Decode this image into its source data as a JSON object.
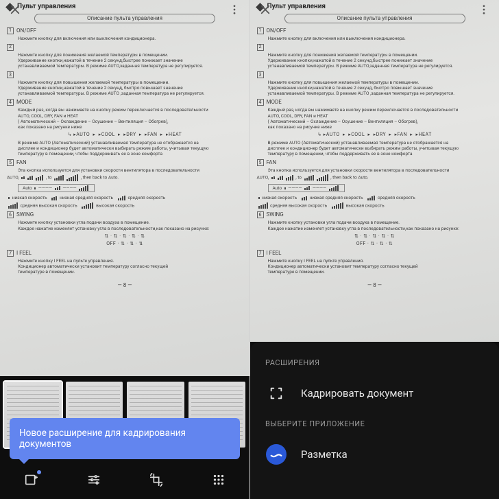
{
  "doc": {
    "title": "Пульт управления",
    "subtitle": "Описание пульта управления",
    "sections": [
      {
        "n": "1",
        "label": "ON/OFF",
        "lines": [
          "Нажмите кнопку для включения или выключения кондиционера."
        ]
      },
      {
        "n": "2",
        "label": "",
        "lines": [
          "Нажмите кнопку для понижения желаемой температуры в помещении.",
          "Удерживание кнопки,нажатой в течение 2 секунд,быстрее понижает значение",
          "устанавливаемой температуры. В режиме AUTO,заданная температура не регулируется."
        ]
      },
      {
        "n": "3",
        "label": "",
        "lines": [
          "Нажмите кнопку для повышения желаемой температуры в помещении.",
          "Удерживание кнопки,нажатой в течение 2 секунд, быстро повышает значение",
          "устанавливаемой температуры. В режиме AUTO ,заданная температура не регулируется."
        ]
      },
      {
        "n": "4",
        "label": "MODE",
        "lines": [
          "Каждый раз, когда вы нажимаете на кнопку режим переключается в последовательности",
          "AUTO, COOL, DRY, FAN и HEAT",
          "( Автоматический – Охлаждение – Осушение – Вентиляция – Обогрев),",
          "как показано на рисунке ниже"
        ]
      },
      {
        "n": "5",
        "label": "FAN",
        "lines": [
          "Эта кнопка используется для установки скорости вентилятора в последовательности"
        ]
      },
      {
        "n": "6",
        "label": "SWING",
        "lines": [
          "Нажмите кнопку установки угла подачи воздуха в помещение.",
          "Каждое нажатие изменяет установку угла в последовательности,как показано на рисунке:"
        ]
      },
      {
        "n": "7",
        "label": "I FEEL",
        "lines": [
          "Нажмите кнопку I FEEL на пульте управления.",
          "Кондиционер автоматически установит температуру согласно текущей",
          "температуре в помещении."
        ]
      }
    ],
    "modeflow": {
      "items": [
        "AUTO",
        "COOL",
        "DRY",
        "FAN",
        "HEAT"
      ]
    },
    "automode_note": [
      "В режиме AUTO (Автоматический) устанавливаемая температура не отображается на",
      "дисплее и кондиционер будет автоматически выбирать режим работы, учитывая текущую",
      "температуру в помещении, чтобы поддерживать ее в зоне комфорта"
    ],
    "fanline": {
      "pre": "AUTO,",
      "mid": ", to",
      "post": ", then back to Auto."
    },
    "fan_low": {
      "label": "Auto"
    },
    "speeds": {
      "low": "низкая скорость",
      "midlow": "низкая средняя скорость",
      "mid": "средняя скорость",
      "midhigh": "средняя высокая скорость",
      "high": "высокая скорость"
    },
    "swing_off": "OFF",
    "page": "— 8 —"
  },
  "tooltip": {
    "text": "Новое расширение для кадрирования документов"
  },
  "sheet": {
    "section1_label": "РАСШИРЕНИЯ",
    "crop_label": "Кадрировать документ",
    "section2_label": "ВЫБЕРИТЕ ПРИЛОЖЕНИЕ",
    "markup_label": "Разметка"
  },
  "icons": {
    "close": "close-icon",
    "more": "more-vert-icon",
    "enhance": "enhance-icon",
    "tune": "tune-icon",
    "crop": "crop-rotate-icon",
    "apps": "grid-icon",
    "cropdoc": "crop-doc-icon",
    "markup": "markup-icon"
  }
}
